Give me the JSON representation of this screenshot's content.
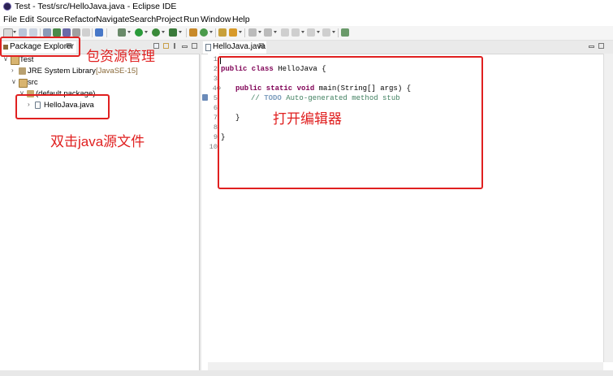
{
  "window": {
    "title": "Test - Test/src/HelloJava.java - Eclipse IDE"
  },
  "menu": {
    "items": [
      "File",
      "Edit",
      "Source",
      "Refactor",
      "Navigate",
      "Search",
      "Project",
      "Run",
      "Window",
      "Help"
    ]
  },
  "package_explorer": {
    "tab_label": "Package Explorer",
    "close_glyph": "⊠",
    "tree": {
      "project": "Test",
      "jre_label": "JRE System Library",
      "jre_version": "[JavaSE-15]",
      "src": "src",
      "package": "(default package)",
      "file": "HelloJava.java"
    }
  },
  "editor": {
    "tab_label": "HelloJava.java",
    "close_glyph": "⊠",
    "line_numbers": [
      "1",
      "2",
      "3",
      "4⊖",
      "5",
      "6",
      "7",
      "8",
      "9",
      "10"
    ],
    "code": {
      "l2_kw": "public class",
      "l2_rest": " HelloJava {",
      "l4_kw": "public static void",
      "l4_rest": " main(String[] args) {",
      "l5_comment": "// ",
      "l5_todo": "TODO",
      "l5_rest": " Auto-generated method stub",
      "l7": "}",
      "l9": "}"
    }
  },
  "annotations": {
    "package_manager": "包资源管理",
    "double_click": "双击java源文件",
    "open_editor": "打开编辑器"
  },
  "colors": {
    "annotation": "#e02020",
    "keyword": "#7f0055",
    "comment": "#3f7f5f",
    "todo": "#7f9fbf"
  }
}
